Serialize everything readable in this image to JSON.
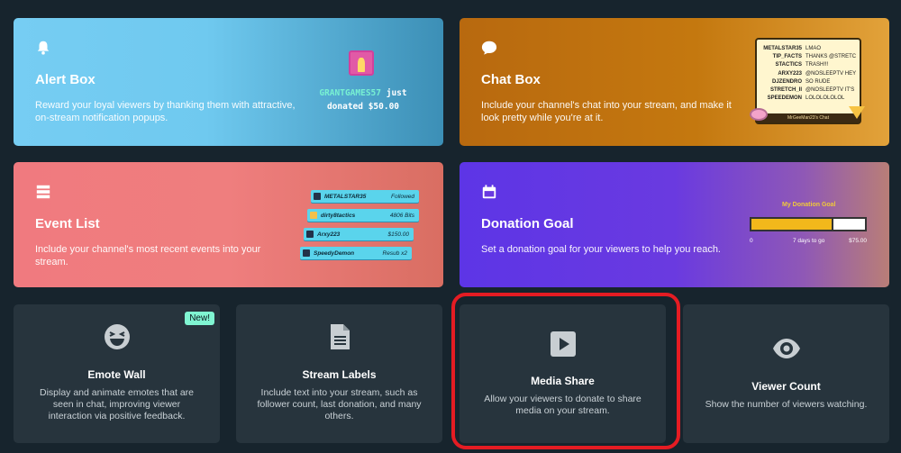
{
  "widgets": {
    "alert_box": {
      "title": "Alert Box",
      "description": "Reward your loyal viewers by thanking them with attractive, on-stream notification popups.",
      "preview_user": "GRANTGAMES57",
      "preview_text_1": "just",
      "preview_text_2": "donated $50.00"
    },
    "chat_box": {
      "title": "Chat Box",
      "description": "Include your channel's chat into your stream, and make it look pretty while you're at it.",
      "preview_rows": [
        {
          "user": "METALSTAR35",
          "message": "LMAO"
        },
        {
          "user": "TIP_FACTS",
          "message": "THANKS @STRETCH_II"
        },
        {
          "user": "STACTICS",
          "message": "TRASH!!!"
        },
        {
          "user": "ARXY223",
          "message": "@NOSLEEPTV HEY"
        },
        {
          "user": "DJZENDRO",
          "message": "SO RUDE"
        },
        {
          "user": "STRETCH_II",
          "message": "@NOSLEEPTV IT'S ON?"
        },
        {
          "user": "SPEEDEMON",
          "message": "LOLOLOLOLOL"
        }
      ],
      "preview_footer": "MrGeeMan23's Chat"
    },
    "event_list": {
      "title": "Event List",
      "description": "Include your channel's most recent events into your stream.",
      "preview_rows": [
        {
          "user": "METALSTAR35",
          "value": "Followed"
        },
        {
          "user": "dirty8tactics",
          "value": "4806 Bits"
        },
        {
          "user": "Arxy223",
          "value": "$150.00"
        },
        {
          "user": "SpeedyDemon",
          "value": "Resub x2"
        }
      ]
    },
    "donation_goal": {
      "title": "Donation Goal",
      "description": "Set a donation goal for your viewers to help you reach.",
      "preview_title": "My Donation Goal",
      "preview_start": "0",
      "preview_days": "7 days to go",
      "preview_target": "$75.00",
      "preview_progress": 0.72
    },
    "emote_wall": {
      "title": "Emote Wall",
      "description": "Display and animate emotes that are seen in chat, improving viewer interaction via positive feedback.",
      "badge": "New!"
    },
    "stream_labels": {
      "title": "Stream Labels",
      "description": "Include text into your stream, such as follower count, last donation, and many others."
    },
    "media_share": {
      "title": "Media Share",
      "description": "Allow your viewers to donate to share media on your stream."
    },
    "viewer_count": {
      "title": "Viewer Count",
      "description": "Show the number of viewers watching."
    }
  },
  "colors": {
    "background": "#17242d",
    "card_dark": "#27343d",
    "highlight": "#e51c23",
    "badge": "#80f5d2"
  },
  "icons": {
    "alert_box": "bell-icon",
    "chat_box": "chat-bubble-icon",
    "event_list": "list-icon",
    "donation_goal": "calendar-icon",
    "emote_wall": "laughing-face-icon",
    "stream_labels": "document-icon",
    "media_share": "play-icon",
    "viewer_count": "eye-icon"
  }
}
